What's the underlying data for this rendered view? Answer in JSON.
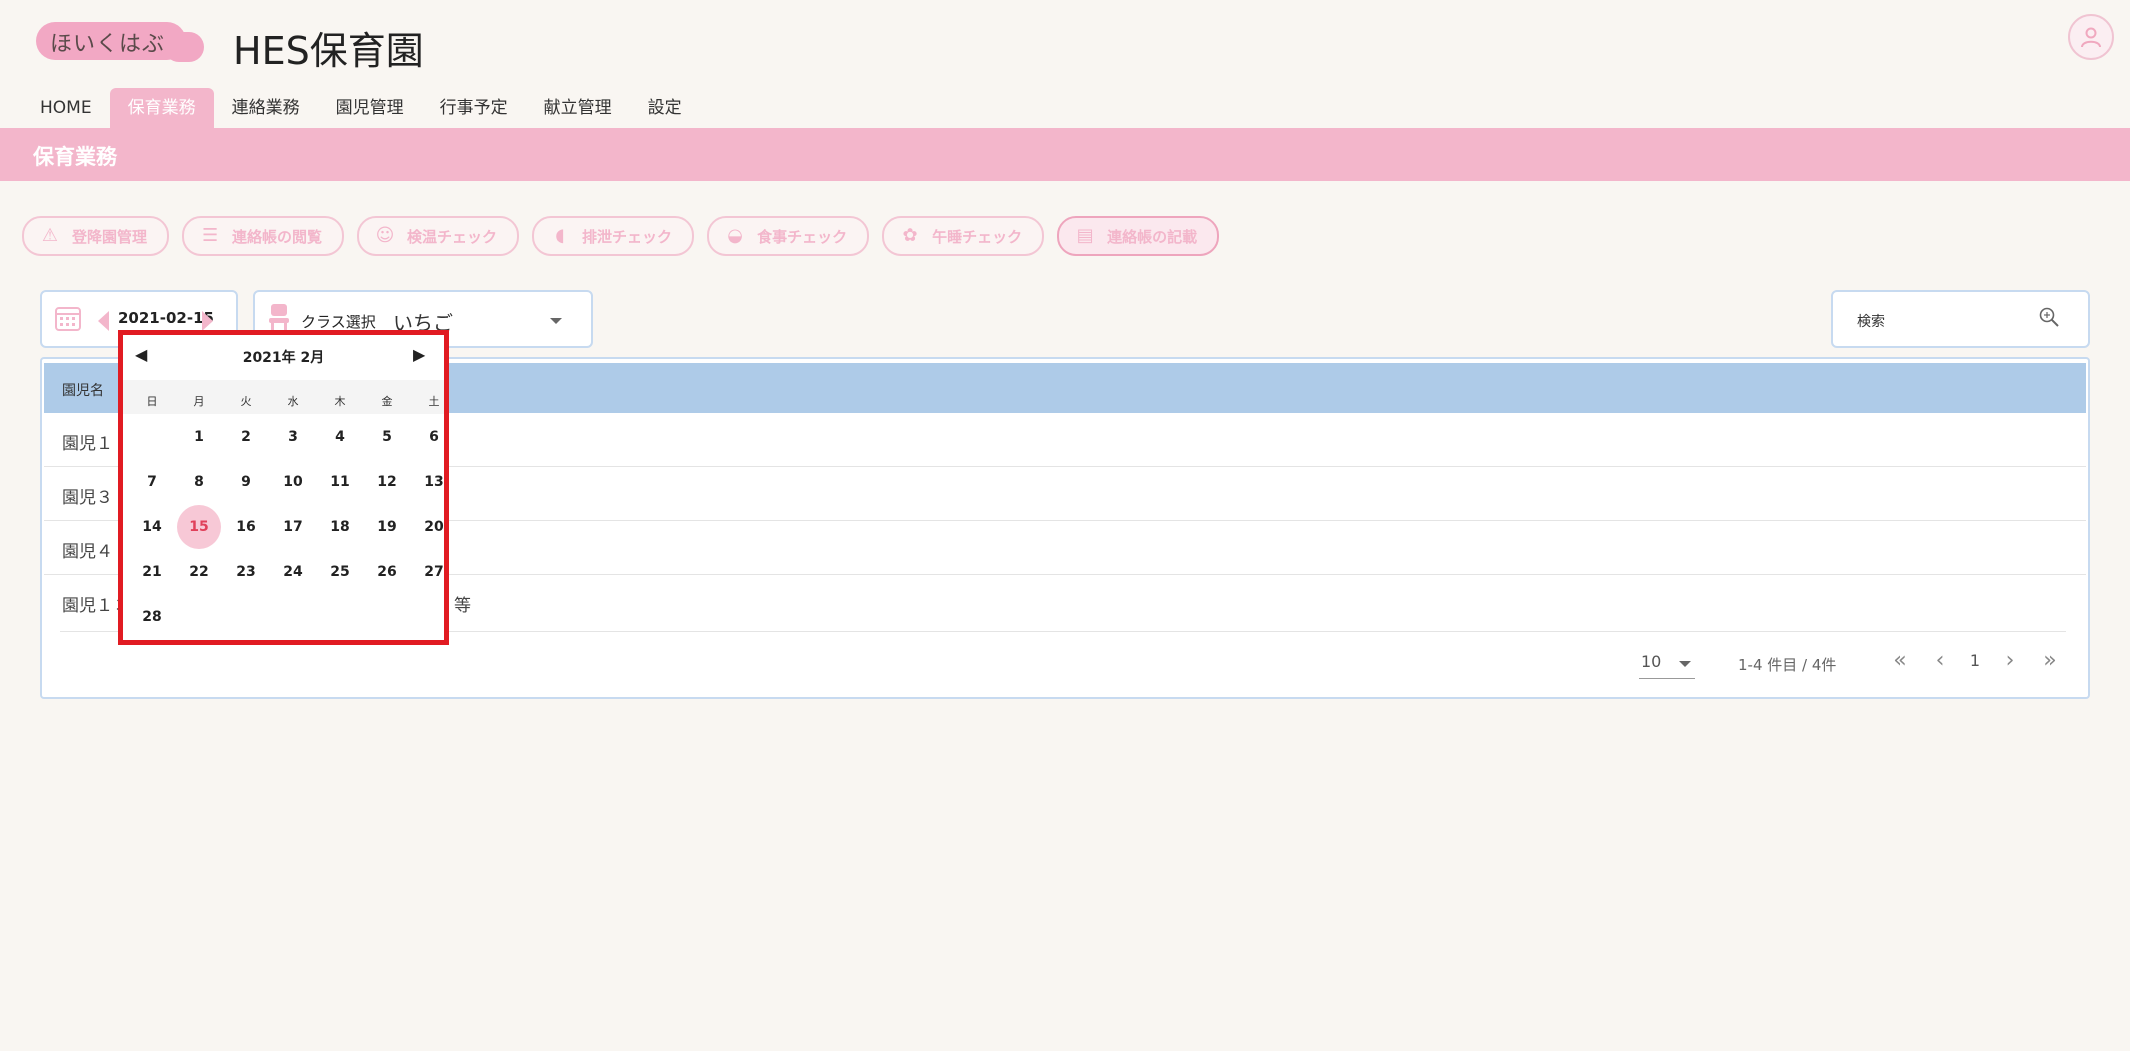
{
  "header": {
    "logo_text": "ほいくはぶ",
    "app_title": "HES保育園",
    "user_icon": "user-icon"
  },
  "nav": [
    {
      "label": "HOME",
      "active": false
    },
    {
      "label": "保育業務",
      "active": true
    },
    {
      "label": "連絡業務",
      "active": false
    },
    {
      "label": "園児管理",
      "active": false
    },
    {
      "label": "行事予定",
      "active": false
    },
    {
      "label": "献立管理",
      "active": false
    },
    {
      "label": "設定",
      "active": false
    }
  ],
  "section_title": "保育業務",
  "toolbar": [
    {
      "label": "登降園管理",
      "icon": "warning-icon"
    },
    {
      "label": "連絡帳の閲覧",
      "icon": "list-icon"
    },
    {
      "label": "検温チェック",
      "icon": "thermometer-icon"
    },
    {
      "label": "排泄チェック",
      "icon": "duck-icon"
    },
    {
      "label": "食事チェック",
      "icon": "bowl-icon"
    },
    {
      "label": "午睡チェック",
      "icon": "bear-icon"
    },
    {
      "label": "連絡帳の記載",
      "icon": "notebook-icon",
      "active": true
    }
  ],
  "date_picker": {
    "value": "2021-02-15"
  },
  "class_select": {
    "label": "クラス選択",
    "value": "いちご"
  },
  "search": {
    "label": "検索"
  },
  "table": {
    "header": "園児名",
    "rows": [
      {
        "name": "園児１",
        "extra": ""
      },
      {
        "name": "園児３",
        "extra": ""
      },
      {
        "name": "園児４",
        "extra": ""
      },
      {
        "name": "園児１３",
        "extra": "等"
      }
    ],
    "per_page": "10",
    "page_info": "1-4 件目 / 4件",
    "current_page": "1"
  },
  "calendar": {
    "month_label": "2021年 2月",
    "prev": "◀",
    "next": "▶",
    "dow": [
      "日",
      "月",
      "火",
      "水",
      "木",
      "金",
      "土"
    ],
    "weeks": [
      [
        "",
        "1",
        "2",
        "3",
        "4",
        "5",
        "6"
      ],
      [
        "7",
        "8",
        "9",
        "10",
        "11",
        "12",
        "13"
      ],
      [
        "14",
        "15",
        "16",
        "17",
        "18",
        "19",
        "20"
      ],
      [
        "21",
        "22",
        "23",
        "24",
        "25",
        "26",
        "27"
      ],
      [
        "28",
        "",
        "",
        "",
        "",
        "",
        ""
      ]
    ],
    "selected": "15"
  },
  "colors": {
    "accent_pink": "#f3b6cb",
    "table_header_blue": "#aecbe8",
    "highlight_red": "#e11b22"
  }
}
